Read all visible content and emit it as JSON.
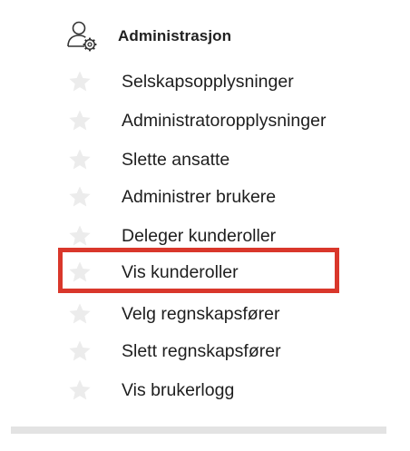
{
  "section": {
    "title": "Administrasjon",
    "icon": "user-settings-icon"
  },
  "items": [
    {
      "label": "Selskapsopplysninger",
      "icon": "star-icon"
    },
    {
      "label": "Administratoropplysninger",
      "icon": "star-icon"
    },
    {
      "label": "Slette ansatte",
      "icon": "star-icon"
    },
    {
      "label": "Administrer brukere",
      "icon": "star-icon"
    },
    {
      "label": "Deleger kunderoller",
      "icon": "star-icon"
    },
    {
      "label": "Vis kunderoller",
      "icon": "star-icon",
      "highlighted": true
    },
    {
      "label": "Velg regnskapsfører",
      "icon": "star-icon"
    },
    {
      "label": "Slett regnskapsfører",
      "icon": "star-icon"
    },
    {
      "label": "Vis brukerlogg",
      "icon": "star-icon"
    }
  ],
  "colors": {
    "highlight": "#d9372b",
    "star": "#ececec",
    "text": "#1e1e1e"
  }
}
